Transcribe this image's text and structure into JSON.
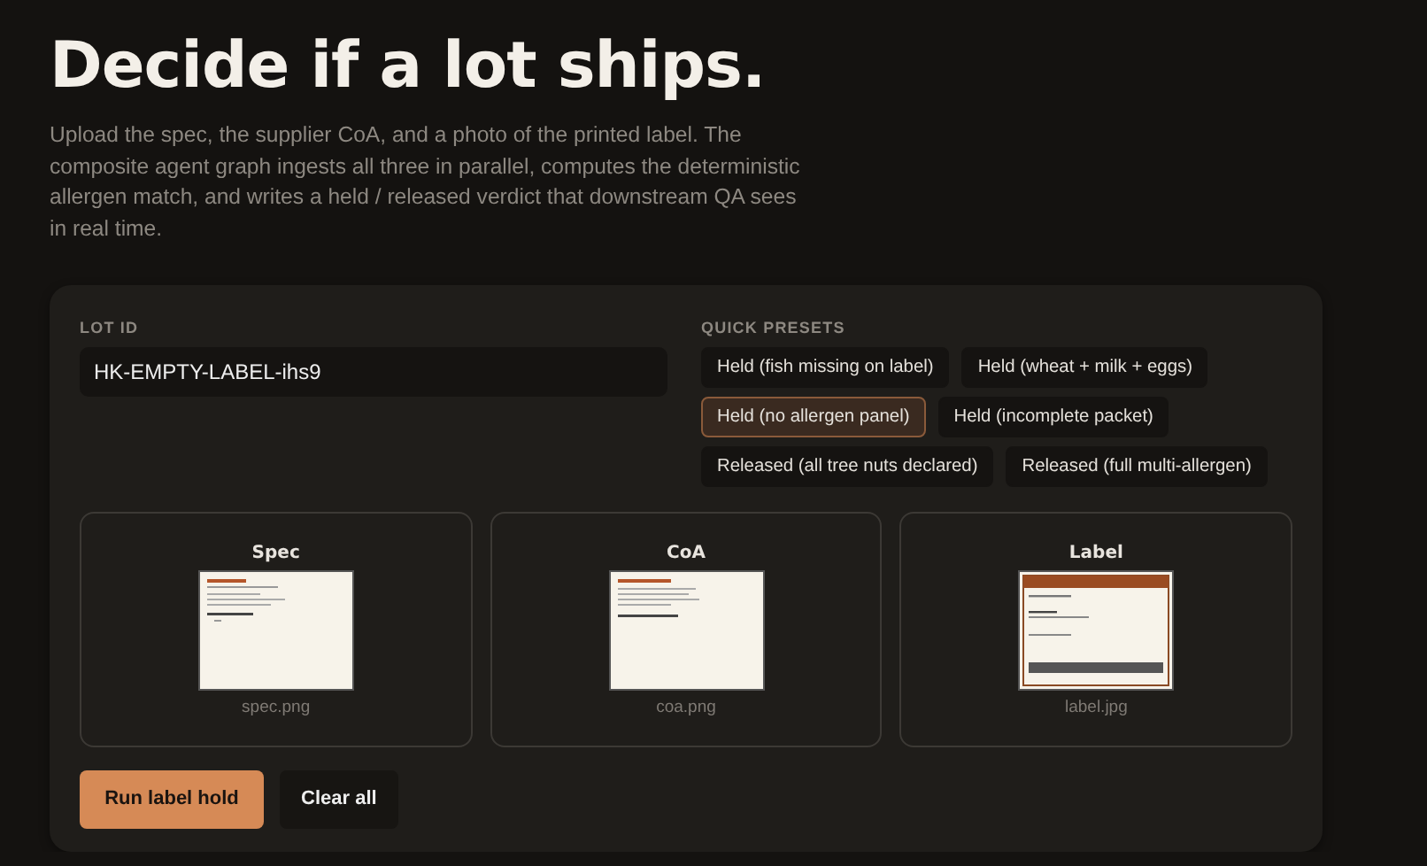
{
  "heading": "Decide if a lot ships.",
  "intro": "Upload the spec, the supplier CoA, and a photo of the printed label. The composite agent graph ingests all three in parallel, computes the deterministic allergen match, and writes a held / released verdict that downstream QA sees in real time.",
  "lot": {
    "label": "LOT ID",
    "value": "HK-EMPTY-LABEL-ihs9"
  },
  "presets": {
    "label": "QUICK PRESETS",
    "items": [
      {
        "label": "Held (fish missing on label)",
        "selected": false
      },
      {
        "label": "Held (wheat + milk + eggs)",
        "selected": false
      },
      {
        "label": "Held (no allergen panel)",
        "selected": true
      },
      {
        "label": "Held (incomplete packet)",
        "selected": false
      },
      {
        "label": "Released (all tree nuts declared)",
        "selected": false
      },
      {
        "label": "Released (full multi-allergen)",
        "selected": false
      }
    ]
  },
  "uploads": [
    {
      "title": "Spec",
      "kind": "spec",
      "file": "spec.png"
    },
    {
      "title": "CoA",
      "kind": "coa",
      "file": "coa.png"
    },
    {
      "title": "Label",
      "kind": "label",
      "file": "label.jpg"
    }
  ],
  "buttons": [
    {
      "label": "Run label hold",
      "kind": "primary"
    },
    {
      "label": "Clear all",
      "kind": "secondary"
    }
  ]
}
